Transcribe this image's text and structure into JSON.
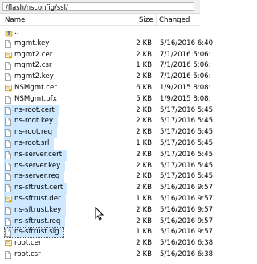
{
  "path": "/flash/nsconfig/ssl/",
  "columns": {
    "name": "Name",
    "size": "Size",
    "changed": "Changed"
  },
  "files": [
    {
      "name": "..",
      "size": "",
      "changed": "",
      "icon": "up-folder",
      "selected": false
    },
    {
      "name": "mgmt.key",
      "size": "2 KB",
      "changed": "5/16/2016 6:40",
      "icon": "file",
      "selected": false
    },
    {
      "name": "mgmt2.cer",
      "size": "2 KB",
      "changed": "7/1/2016 5:06:",
      "icon": "certificate",
      "selected": false
    },
    {
      "name": "mgmt2.csr",
      "size": "1 KB",
      "changed": "7/1/2016 5:06:",
      "icon": "file",
      "selected": false
    },
    {
      "name": "mgmt2.key",
      "size": "2 KB",
      "changed": "7/1/2016 5:06:",
      "icon": "file",
      "selected": false
    },
    {
      "name": "NSMgmt.cer",
      "size": "6 KB",
      "changed": "1/9/2015 8:08:",
      "icon": "certificate",
      "selected": false
    },
    {
      "name": "NSMgmt.pfx",
      "size": "5 KB",
      "changed": "1/9/2015 8:08:",
      "icon": "file",
      "selected": false
    },
    {
      "name": "ns-root.cert",
      "size": "2 KB",
      "changed": "5/17/2016 5:45",
      "icon": "file",
      "selected": true
    },
    {
      "name": "ns-root.key",
      "size": "2 KB",
      "changed": "5/17/2016 5:45",
      "icon": "file",
      "selected": true
    },
    {
      "name": "ns-root.req",
      "size": "2 KB",
      "changed": "5/17/2016 5:45",
      "icon": "file",
      "selected": true
    },
    {
      "name": "ns-root.srl",
      "size": "1 KB",
      "changed": "5/17/2016 5:45",
      "icon": "file",
      "selected": true
    },
    {
      "name": "ns-server.cert",
      "size": "2 KB",
      "changed": "5/17/2016 5:45",
      "icon": "file",
      "selected": true
    },
    {
      "name": "ns-server.key",
      "size": "2 KB",
      "changed": "5/17/2016 5:45",
      "icon": "file",
      "selected": true
    },
    {
      "name": "ns-server.req",
      "size": "2 KB",
      "changed": "5/17/2016 5:45",
      "icon": "file",
      "selected": true
    },
    {
      "name": "ns-sftrust.cert",
      "size": "2 KB",
      "changed": "5/16/2016 9:57",
      "icon": "file",
      "selected": true
    },
    {
      "name": "ns-sftrust.der",
      "size": "1 KB",
      "changed": "5/16/2016 9:57",
      "icon": "certificate",
      "selected": true
    },
    {
      "name": "ns-sftrust.key",
      "size": "2 KB",
      "changed": "5/16/2016 9:57",
      "icon": "file",
      "selected": true
    },
    {
      "name": "ns-sftrust.req",
      "size": "2 KB",
      "changed": "5/16/2016 9:57",
      "icon": "file",
      "selected": true
    },
    {
      "name": "ns-sftrust.sig",
      "size": "1 KB",
      "changed": "5/16/2016 9:57",
      "icon": "file",
      "selected": true,
      "focused": true
    },
    {
      "name": "root.cer",
      "size": "2 KB",
      "changed": "5/16/2016 6:38",
      "icon": "certificate",
      "selected": false
    },
    {
      "name": "root.csr",
      "size": "2 KB",
      "changed": "5/16/2016 6:38",
      "icon": "file",
      "selected": false
    }
  ],
  "colors": {
    "selection": "#cde8ff",
    "cert_icon": "#f5c542"
  }
}
